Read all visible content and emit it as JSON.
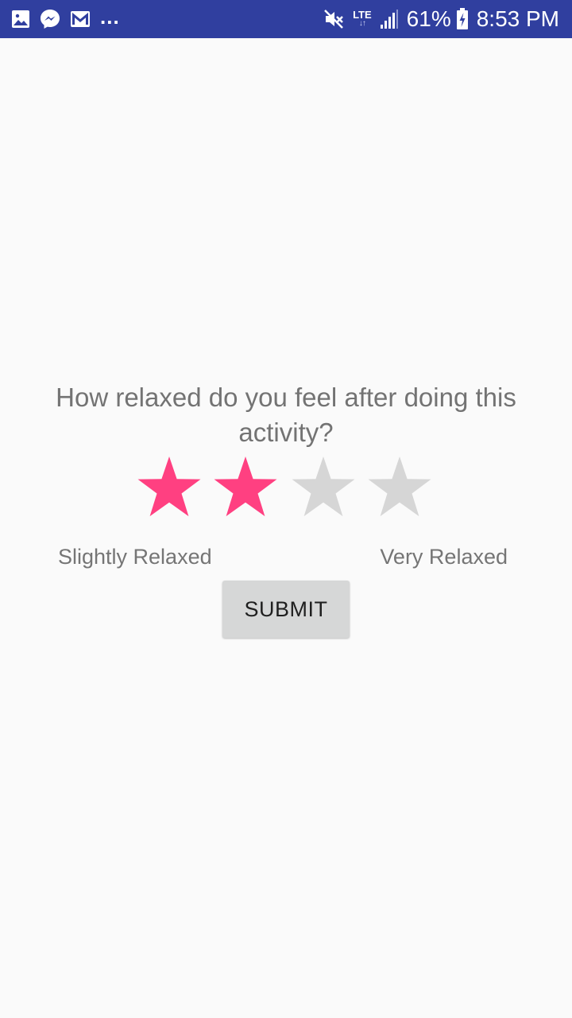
{
  "status_bar": {
    "notification_icons": [
      "gallery-icon",
      "messenger-icon",
      "gmail-icon"
    ],
    "overflow": "...",
    "mute_icon": "mute-icon",
    "network": "LTE",
    "network_arrows": "↓↑",
    "signal_icon": "signal-icon",
    "battery_percent": "61%",
    "battery_icon": "battery-charging-icon",
    "time": "8:53 PM"
  },
  "rating": {
    "question": "How relaxed do you feel after doing this activity?",
    "value": 2,
    "max": 4,
    "label_min": "Slightly Relaxed",
    "label_max": "Very Relaxed"
  },
  "submit_label": "SUBMIT",
  "colors": {
    "status_bar": "#303f9f",
    "star_filled": "#ff4081",
    "star_empty": "#d6d6d6",
    "background": "#fafafa",
    "button": "#d6d7d7"
  }
}
